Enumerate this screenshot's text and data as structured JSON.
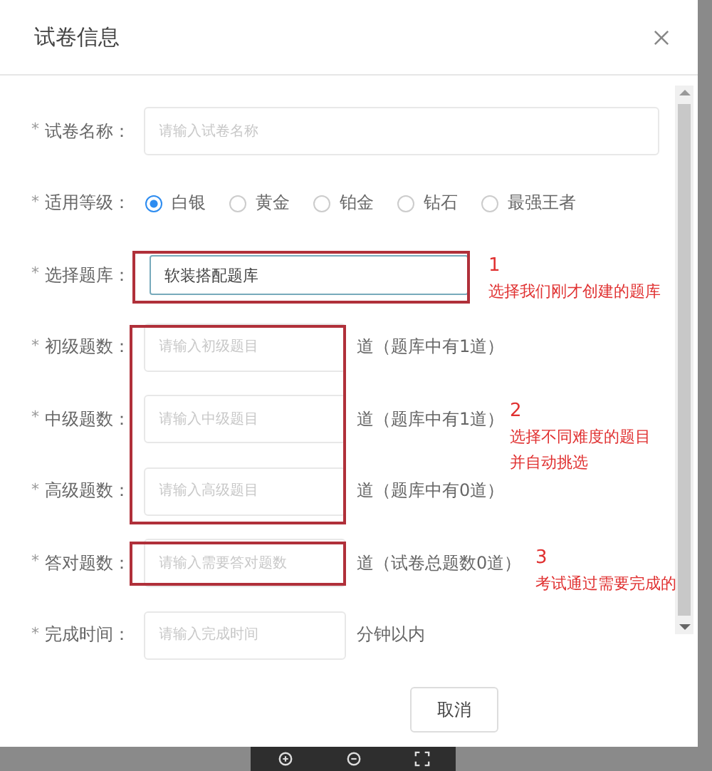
{
  "dialog": {
    "title": "试卷信息"
  },
  "fields": [
    {
      "kind": "text",
      "required_mark": "*",
      "label": "试卷名称：",
      "placeholder": "请输入试卷名称"
    },
    {
      "kind": "radio",
      "required_mark": "*",
      "label": "适用等级：",
      "options": [
        {
          "label": "白银",
          "selected": true
        },
        {
          "label": "黄金",
          "selected": false
        },
        {
          "label": "铂金",
          "selected": false
        },
        {
          "label": "钻石",
          "selected": false
        },
        {
          "label": "最强王者",
          "selected": false
        }
      ]
    },
    {
      "kind": "select",
      "required_mark": "*",
      "label": "选择题库：",
      "value": "软装搭配题库"
    },
    {
      "kind": "number",
      "required_mark": "*",
      "label": "初级题数：",
      "placeholder": "请输入初级题目",
      "suffix": "道（题库中有1道）"
    },
    {
      "kind": "number",
      "required_mark": "*",
      "label": "中级题数：",
      "placeholder": "请输入中级题目",
      "suffix": "道（题库中有1道）"
    },
    {
      "kind": "number",
      "required_mark": "*",
      "label": "高级题数：",
      "placeholder": "请输入高级题目",
      "suffix": "道（题库中有0道）"
    },
    {
      "kind": "number",
      "required_mark": "*",
      "label": "答对题数：",
      "placeholder": "请输入需要答对题数",
      "suffix": "道（试卷总题数0道）"
    },
    {
      "kind": "number",
      "required_mark": "*",
      "label": "完成时间：",
      "placeholder": "请输入完成时间",
      "suffix": "分钟以内"
    }
  ],
  "annotations": [
    {
      "number": "1",
      "lines": [
        "选择我们刚才创建的题库"
      ]
    },
    {
      "number": "2",
      "lines": [
        "选择不同难度的题目",
        "并自动挑选"
      ]
    },
    {
      "number": "3",
      "lines": [
        "考试通过需要完成的"
      ]
    }
  ],
  "buttons": [
    "取消"
  ]
}
